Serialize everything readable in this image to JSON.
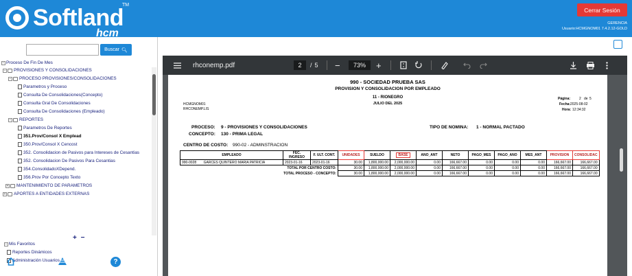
{
  "header": {
    "logo_text": "Softland",
    "logo_tm": "TM",
    "logo_sub": "hcm",
    "logout_label": "Cerrar Sesión",
    "company": "GERENCIA",
    "user": "Usuario:HCMGNOM01 7.4.2.12-GOLD"
  },
  "left_panel": {
    "search_placeholder": "",
    "search_button": "Buscar",
    "tree": [
      {
        "label": "Proceso De Fin De Mes"
      },
      {
        "label": "PROVISIONES Y CONSOLIDACIONES"
      },
      {
        "label": "PROCESO PROVISIONES/CONSOLIDACIONES"
      },
      {
        "label": "Parametros y Proceso"
      },
      {
        "label": "Consulta De Consolidaciones(Concepto)"
      },
      {
        "label": "Consulta Gral De Consolidaciones"
      },
      {
        "label": "Consulta De Consolidaciones (Empleado)"
      },
      {
        "label": "REPORTES"
      },
      {
        "label": "Parametros De Reportes"
      },
      {
        "label": "351.Prov/Consol X Emplead"
      },
      {
        "label": "350.Prov/Consol X Cencost"
      },
      {
        "label": "352. Consolidacion de Pasivos para Intereses de Cesantias"
      },
      {
        "label": "352. Consolidacion De Pasivos Para Cesantias"
      },
      {
        "label": "354.ConsolidadoXDepend."
      },
      {
        "label": "356.Prov Por Concepto Texto"
      },
      {
        "label": "MANTENIMIENTO DE PARAMETROS"
      },
      {
        "label": "APORTES A ENTIDADES EXTERNAS"
      }
    ],
    "expand_all": "+",
    "collapse_all": "−",
    "favorites_title": "Mis Favoritos",
    "favorites": [
      {
        "label": "Reportes Dinámicos"
      },
      {
        "label": "Administración Usuarios"
      }
    ],
    "help_label": "?"
  },
  "pdf_viewer": {
    "file_name": "rhconemp.pdf",
    "current_page": "2",
    "page_separator": "/",
    "total_pages": "5",
    "zoom": "73%",
    "minus": "−",
    "plus": "+"
  },
  "report": {
    "company": "990 - SOCIEDAD  PRUEBA SAS",
    "title": "PROVISION Y CONSOLIDACION POR EMPLEADO",
    "branch": "11 - RIONEGRO",
    "period": "JULIO DEL 2025",
    "user_code": "HCMGNOM01",
    "file_code": "RHCONEMP.LIS",
    "page_label": "Página:",
    "page_value": "2",
    "page_of": "de",
    "page_total": "5",
    "date_label": "Fecha:",
    "date_value": "2025-08-02",
    "time_label": "Hora:",
    "time_value": "12:34:32",
    "proceso_label": "PROCESO:",
    "proceso_value": "9 - PROVISIONES Y CONSOLIDACIONES",
    "tipo_nomina_label": "TIPO DE NOMINA:",
    "tipo_nomina_value": "1 - NORMAL PACTADO",
    "concepto_label": "CONCEPTO:",
    "concepto_value": "130 - PRIMA LEGAL",
    "centro_label": "CENTRO DE COSTO:",
    "centro_value": "990-02 - ADMINSTRACION",
    "columns": [
      "EMPLEADO",
      "FEC. INGRESO",
      "F. ULT. CONT.",
      "UNIDADES",
      "SUELDO",
      "BASE",
      "ANO_ANT",
      "NETO",
      "PAGO_MES",
      "PAGO_ANO",
      "MES_ANT",
      "PROVISION",
      "CONSOLIDAC"
    ],
    "rows": [
      [
        "990-0028",
        "GARCES QUINTERO MARIA PATRICIA",
        "2023-01-16",
        "2023-01-16",
        "30.00",
        "1,800,000.00",
        "2,000,000.00",
        "0.00",
        "166,667.00",
        "0.00",
        "0.00",
        "0.00",
        "166,667.00",
        "166,667.00"
      ]
    ],
    "total_centro_label": "TOTAL POR CENTRO COSTO:",
    "total_centro": [
      "30.00",
      "1,800,000.00",
      "2,000,000.00",
      "0.00",
      "166,667.00",
      "0.00",
      "0.00",
      "0.00",
      "166,667.00",
      "166,667.00"
    ],
    "total_proceso_label": "TOTAL PROCESO - CONCEPTO:",
    "total_proceso": [
      "30.00",
      "1,800,000.00",
      "2,000,000.00",
      "0.00",
      "166,667.00",
      "0.00",
      "0.00",
      "0.00",
      "166,667.00",
      "166,667.00"
    ]
  },
  "colors": {
    "brand": "#1e88d7",
    "logout": "#e53935",
    "highlight": "#e53935",
    "toolbar": "#323639"
  }
}
